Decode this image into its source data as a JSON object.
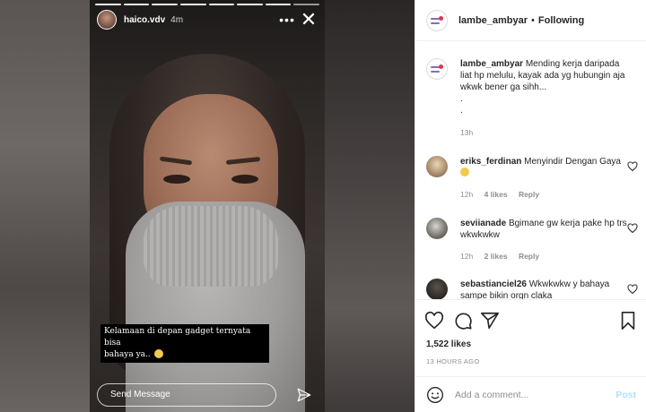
{
  "story": {
    "username": "haico.vdv",
    "time": "4m",
    "more_icon": "ellipsis-horizontal-icon",
    "close_icon": "close-icon",
    "progress": {
      "total_segments": 8,
      "completed_segments": 7
    },
    "caption_line1": "Kelamaan di depan gadget ternyata bisa",
    "caption_line2": "bahaya ya..",
    "reply_placeholder": "Send Message"
  },
  "post": {
    "header": {
      "username": "lambe_ambyar",
      "separator": "•",
      "follow_status": "Following"
    },
    "caption": {
      "username": "lambe_ambyar",
      "text": "Mending kerja daripada liat hp melulu, kayak ada yg hubungin aja wkwk bener ga sihh...",
      "dot1": ".",
      "dot2": ".",
      "time": "13h"
    },
    "comments": [
      {
        "username": "eriks_ferdinan",
        "text": "Menyindir Dengan Gaya",
        "time": "12h",
        "likes": "4 likes",
        "reply": "Reply"
      },
      {
        "username": "seviianade",
        "text": "Bgimane gw kerja pake hp trs wkwkwkw",
        "time": "12h",
        "likes": "2 likes",
        "reply": "Reply"
      },
      {
        "username": "sebastianciel26",
        "text": "Wkwkwkw y bahaya sampe bikin orgn claka"
      }
    ],
    "likes": "1,522 likes",
    "posted": "13 HOURS AGO",
    "add_comment_placeholder": "Add a comment...",
    "post_label": "Post",
    "colors": {
      "post_button": "#b2dffc",
      "meta": "#8e8e8e",
      "brand_accent": "#e8334a"
    }
  }
}
